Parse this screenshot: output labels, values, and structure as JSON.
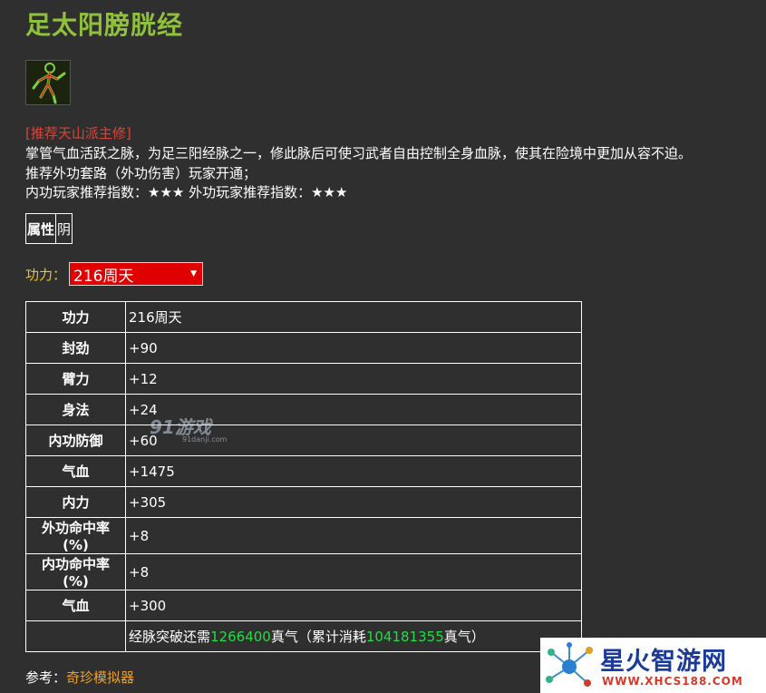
{
  "page": {
    "title": "足太阳膀胱经",
    "recommend_tag": "[推荐天山派主修]",
    "desc_lines": [
      "掌管气血活跃之脉，为足三阳经脉之一，修此脉后可使习武者自由控制全身血脉，使其在险境中更加从容不迫。",
      "推荐外功套路（外功伤害）玩家开通；",
      "内功玩家推荐指数：★★★ 外功玩家推荐指数：★★★"
    ],
    "attribute": {
      "key": "属性",
      "value": "阴"
    },
    "power": {
      "label": "功力：",
      "selected": "216周天"
    },
    "stats": [
      {
        "k": "功力",
        "v": "216周天"
      },
      {
        "k": "封劲",
        "v": "+90"
      },
      {
        "k": "臂力",
        "v": "+12"
      },
      {
        "k": "身法",
        "v": "+24"
      },
      {
        "k": "内功防御",
        "v": "+60"
      },
      {
        "k": "气血",
        "v": "+1475"
      },
      {
        "k": "内力",
        "v": "+305"
      },
      {
        "k": "外功命中率(%)",
        "v": "+8"
      },
      {
        "k": "内功命中率(%)",
        "v": "+8"
      },
      {
        "k": "气血",
        "v": "+300"
      }
    ],
    "breakthrough": {
      "t1": "经脉突破还需",
      "n1": "1266400",
      "t2": "真气（累计消耗",
      "n2": "104181355",
      "t3": "真气）"
    },
    "reference": {
      "label": "参考：",
      "link": "奇珍模拟器"
    }
  },
  "watermarks": {
    "mid": {
      "logo": "91游戏",
      "site": "91danji.com"
    },
    "corner": {
      "name": "星火智游网",
      "url": "WWW.XHCS188.COM"
    }
  },
  "colors": {
    "background": "#2f2f2f",
    "title": "#8fc13a",
    "recommend": "#d9443a",
    "power_label": "#f0c419",
    "select_bg": "#e00000",
    "highlight_number": "#22dd44",
    "link": "#f0a020"
  },
  "icons": {
    "meridian": "meridian-figure-icon",
    "dropdown": "caret-down-icon"
  }
}
